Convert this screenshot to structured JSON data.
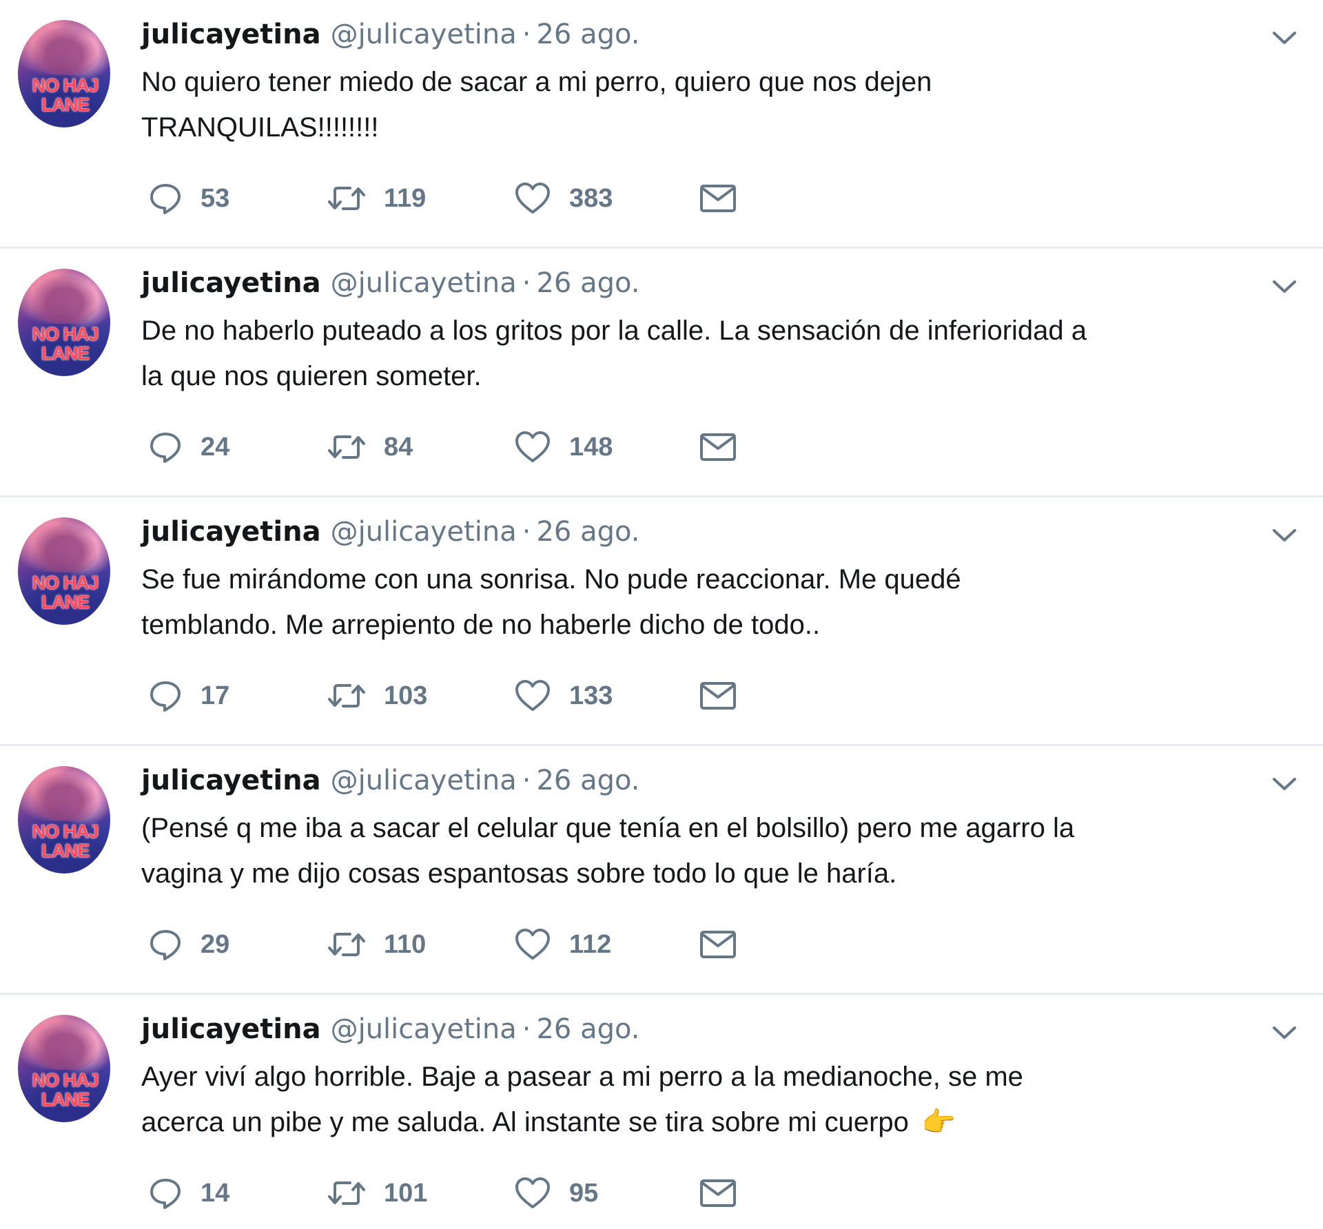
{
  "colors": {
    "text": "#14171a",
    "muted": "#657786",
    "divider": "#e6ecf0",
    "emoji": "#ffcc33"
  },
  "icons": {
    "reply": "reply-icon",
    "retweet": "retweet-icon",
    "like": "heart-icon",
    "dm": "envelope-icon",
    "caret": "chevron-down-icon",
    "emoji": "backhand-index-pointing-right-emoji"
  },
  "tweets": [
    {
      "avatar_text": [
        "NO HAJ",
        "LANE"
      ],
      "name": "julicayetina",
      "handle": "@julicayetina",
      "separator": "·",
      "date": "26 ago.",
      "text": "No quiero tener miedo de sacar a mi perro, quiero que nos dejen\nTRANQUILAS!!!!!!!!",
      "replies": "53",
      "retweets": "119",
      "likes": "383"
    },
    {
      "avatar_text": [
        "NO HAJ",
        "LANE"
      ],
      "name": "julicayetina",
      "handle": "@julicayetina",
      "separator": "·",
      "date": "26 ago.",
      "text": "De no haberlo puteado a los gritos por la calle. La sensación de inferioridad a\nla que nos quieren someter.",
      "replies": "24",
      "retweets": "84",
      "likes": "148"
    },
    {
      "avatar_text": [
        "NO HAJ",
        "LANE"
      ],
      "name": "julicayetina",
      "handle": "@julicayetina",
      "separator": "·",
      "date": "26 ago.",
      "text": "Se fue mirándome con una sonrisa. No pude reaccionar. Me quedé\ntemblando. Me arrepiento de no haberle dicho de todo..",
      "replies": "17",
      "retweets": "103",
      "likes": "133"
    },
    {
      "avatar_text": [
        "NO HAJ",
        "LANE"
      ],
      "name": "julicayetina",
      "handle": "@julicayetina",
      "separator": "·",
      "date": "26 ago.",
      "text": "(Pensé q me iba a sacar el celular que tenía en el bolsillo) pero me agarro la\nvagina y me dijo cosas espantosas sobre todo lo que le haría.",
      "replies": "29",
      "retweets": "110",
      "likes": "112"
    },
    {
      "avatar_text": [
        "NO HAJ",
        "LANE"
      ],
      "name": "julicayetina",
      "handle": "@julicayetina",
      "separator": "·",
      "date": "26 ago.",
      "text": "Ayer viví algo horrible. Baje a pasear a mi perro a la medianoche, se me\nacerca un pibe y me saluda. Al instante se tira sobre mi cuerpo",
      "emoji": "👉",
      "replies": "14",
      "retweets": "101",
      "likes": "95"
    }
  ]
}
